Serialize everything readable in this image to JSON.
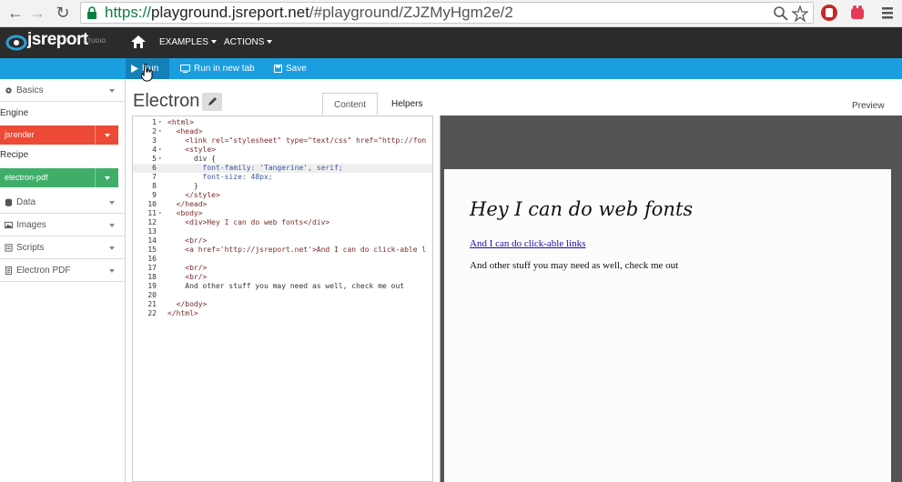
{
  "browser": {
    "url_protocol": "https://",
    "url_host": "playground.jsreport.net",
    "url_path": "/#playground/ZJZMyHgm2e/2",
    "back_icon": "back-arrow-icon",
    "forward_icon": "forward-arrow-icon",
    "reload_icon": "reload-icon"
  },
  "app": {
    "logo_text": "jsreport",
    "logo_sub": "STUDIO",
    "menu": [
      {
        "label": "EXAMPLES"
      },
      {
        "label": "ACTIONS"
      }
    ]
  },
  "toolbar": {
    "run_label": "Run",
    "run_new_tab_label": "Run in new tab",
    "save_label": "Save"
  },
  "sidebar": {
    "basics_label": "Basics",
    "engine_label": "Engine",
    "engine_value": "jsrender",
    "engine_color": "#ec4a36",
    "recipe_label": "Recipe",
    "recipe_value": "electron-pdf",
    "recipe_color": "#3fae69",
    "sections": [
      {
        "label": "Data",
        "icon": "data-icon"
      },
      {
        "label": "Images",
        "icon": "image-icon"
      },
      {
        "label": "Scripts",
        "icon": "script-icon"
      },
      {
        "label": "Electron PDF",
        "icon": "document-icon"
      }
    ]
  },
  "editor": {
    "template_name": "Electron",
    "tab_content": "Content",
    "tab_helpers": "Helpers",
    "preview_label": "Preview",
    "active_line": 6,
    "lines": [
      {
        "n": "1",
        "text": "<html>"
      },
      {
        "n": "2",
        "text": "  <head>"
      },
      {
        "n": "3",
        "text": "    <link rel=\"stylesheet\" type=\"text/css\" href=\"http://fon"
      },
      {
        "n": "4",
        "text": "    <style>"
      },
      {
        "n": "5",
        "text": "      div {"
      },
      {
        "n": "6",
        "text": "        font-family: 'Tangerine', serif;"
      },
      {
        "n": "7",
        "text": "        font-size: 48px;"
      },
      {
        "n": "8",
        "text": "      }"
      },
      {
        "n": "9",
        "text": "    </style>"
      },
      {
        "n": "10",
        "text": "  </head>"
      },
      {
        "n": "11",
        "text": "  <body>"
      },
      {
        "n": "12",
        "text": "    <div>Hey I can do web fonts</div>"
      },
      {
        "n": "13",
        "text": ""
      },
      {
        "n": "14",
        "text": "    <br/>"
      },
      {
        "n": "15",
        "text": "    <a href='http://jsreport.net'>And I can do click-able l"
      },
      {
        "n": "16",
        "text": ""
      },
      {
        "n": "17",
        "text": "    <br/>"
      },
      {
        "n": "18",
        "text": "    <br/>"
      },
      {
        "n": "19",
        "text": "    And other stuff you may need as well, check me out"
      },
      {
        "n": "20",
        "text": ""
      },
      {
        "n": "21",
        "text": "  </body>"
      },
      {
        "n": "22",
        "text": "</html>"
      }
    ],
    "fold_lines": [
      "1",
      "2",
      "4",
      "5",
      "11"
    ]
  },
  "preview": {
    "heading": "Hey I can do web fonts",
    "link_text": "And I can do click-able links",
    "body_text": "And other stuff you may need as well, check me out"
  }
}
